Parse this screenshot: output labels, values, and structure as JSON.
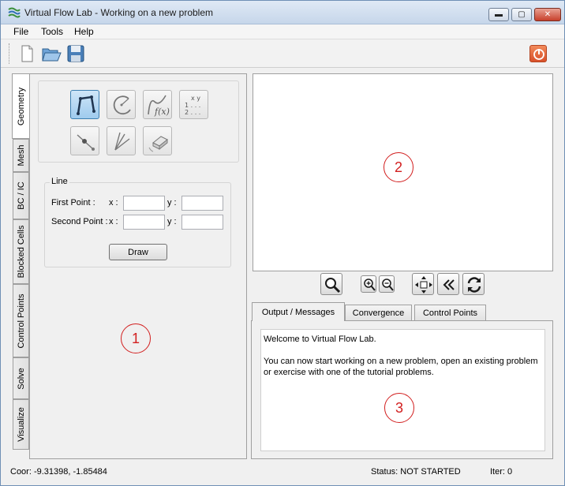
{
  "window": {
    "title": "Virtual Flow Lab - Working on a new problem",
    "minimize": "▬",
    "maximize": "▢",
    "close": "✕"
  },
  "menu": {
    "file": "File",
    "tools": "Tools",
    "help": "Help"
  },
  "toolbar": {
    "new_icon": "new-file-icon",
    "open_icon": "open-folder-icon",
    "save_icon": "save-icon",
    "power_icon": "power-icon"
  },
  "side_tabs": [
    "Geometry",
    "Mesh",
    "BC / IC",
    "Blocked Cells",
    "Control Points",
    "Solve",
    "Visualize"
  ],
  "geometry": {
    "tools": [
      "line-tool",
      "arc-tool",
      "function-curve-tool",
      "points-file-tool",
      "point-tool",
      "lines-tool",
      "eraser-tool"
    ],
    "function_label": "f(x)",
    "points_label_top": "x  y",
    "points_label_rows": "1 . . .\n2 . . .",
    "line_group_title": "Line",
    "first_point_label": "First Point :",
    "second_point_label": "Second Point :",
    "x_label": "x :",
    "y_label": "y :",
    "first_x": "",
    "first_y": "",
    "second_x": "",
    "second_y": "",
    "draw_button": "Draw"
  },
  "view_controls": [
    "zoom-icon",
    "zoom-in-icon",
    "zoom-out-icon",
    "pan-icon",
    "back-icon",
    "refresh-icon"
  ],
  "output_tabs": [
    "Output / Messages",
    "Convergence",
    "Control Points"
  ],
  "output": {
    "line1": "Welcome to Virtual Flow Lab.",
    "line2": "You can now start working on a new problem, open an existing problem",
    "line3": "or exercise with one of the tutorial problems."
  },
  "markers": {
    "one": "1",
    "two": "2",
    "three": "3"
  },
  "status": {
    "coordinates": "Coor: -9.31398, -1.85484",
    "status": "Status: NOT STARTED",
    "iter": "Iter: 0"
  },
  "colors": {
    "marker": "#d21f1f",
    "selected_tool": "#9fcbee",
    "power_button": "#d8502a"
  }
}
